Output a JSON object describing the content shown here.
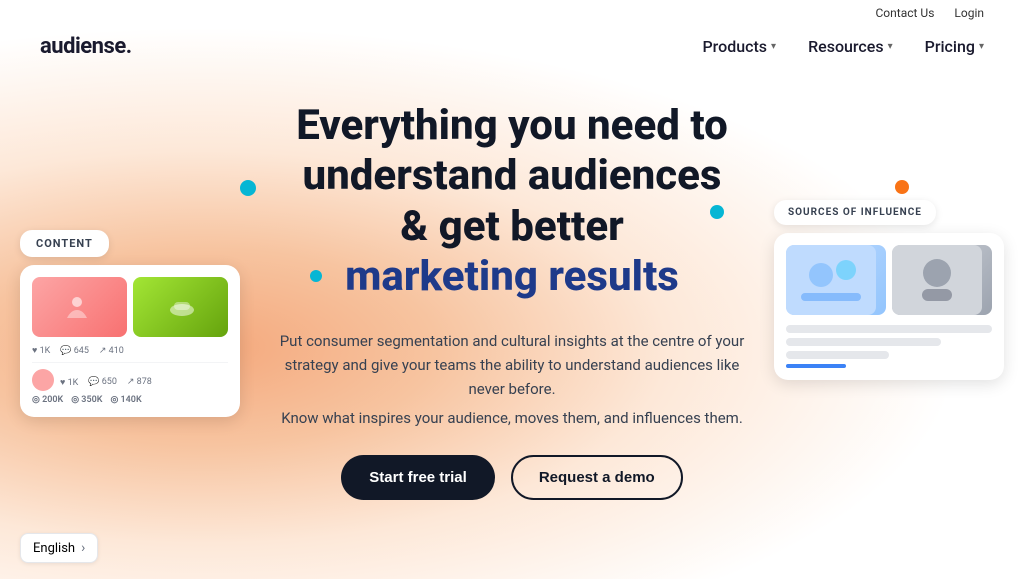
{
  "topbar": {
    "contact_us": "Contact Us",
    "login": "Login"
  },
  "navbar": {
    "logo": "audiense.",
    "links": [
      {
        "label": "Products",
        "has_dropdown": true
      },
      {
        "label": "Resources",
        "has_dropdown": true
      },
      {
        "label": "Pricing",
        "has_dropdown": true
      }
    ]
  },
  "hero": {
    "headline_line1": "Everything you need to",
    "headline_line2": "understand audiences",
    "headline_line3": "& get better",
    "headline_line4": "marketing results",
    "subtext1": "Put consumer segmentation and cultural insights at the centre of your strategy and give your teams the ability to understand audiences like never before.",
    "subtext2": "Know what inspires your audience, moves them, and influences them.",
    "cta_primary": "Start free trial",
    "cta_secondary": "Request a demo"
  },
  "left_card": {
    "tag": "CONTENT",
    "stats_row1": [
      "200K",
      "350K",
      "140K"
    ],
    "stats_row2": [
      "1K",
      "650",
      "878"
    ]
  },
  "right_card": {
    "tag": "SOURCES OF INFLUENCE"
  },
  "language": {
    "label": "English",
    "chevron": "›"
  },
  "dots": {
    "teal": "#06b6d4",
    "orange": "#f97316"
  }
}
